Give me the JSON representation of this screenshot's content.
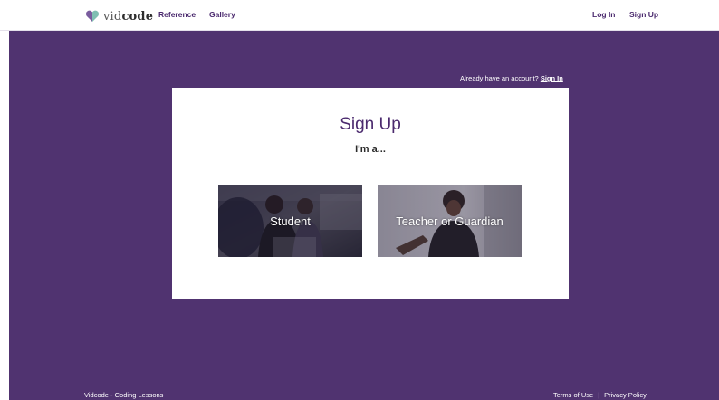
{
  "brand": {
    "logo_icon": "heart-icon",
    "logo_text_light": "vid",
    "logo_text_bold": "code",
    "colors": {
      "purple": "#503370",
      "accent": "#4b2a6e",
      "heart_purple": "#7a5c9e",
      "heart_teal": "#7fbfb2"
    }
  },
  "nav": {
    "reference": "Reference",
    "gallery": "Gallery",
    "log_in": "Log In",
    "sign_up": "Sign Up"
  },
  "account_prompt": {
    "text": "Already have an account? ",
    "link": "Sign In"
  },
  "signup_card": {
    "title": "Sign Up",
    "subtitle": "I'm a...",
    "options": [
      {
        "label": "Student"
      },
      {
        "label": "Teacher or Guardian"
      }
    ]
  },
  "footer": {
    "left": "Vidcode - Coding Lessons",
    "terms": "Terms of Use",
    "separator": "|",
    "privacy": "Privacy Policy"
  }
}
